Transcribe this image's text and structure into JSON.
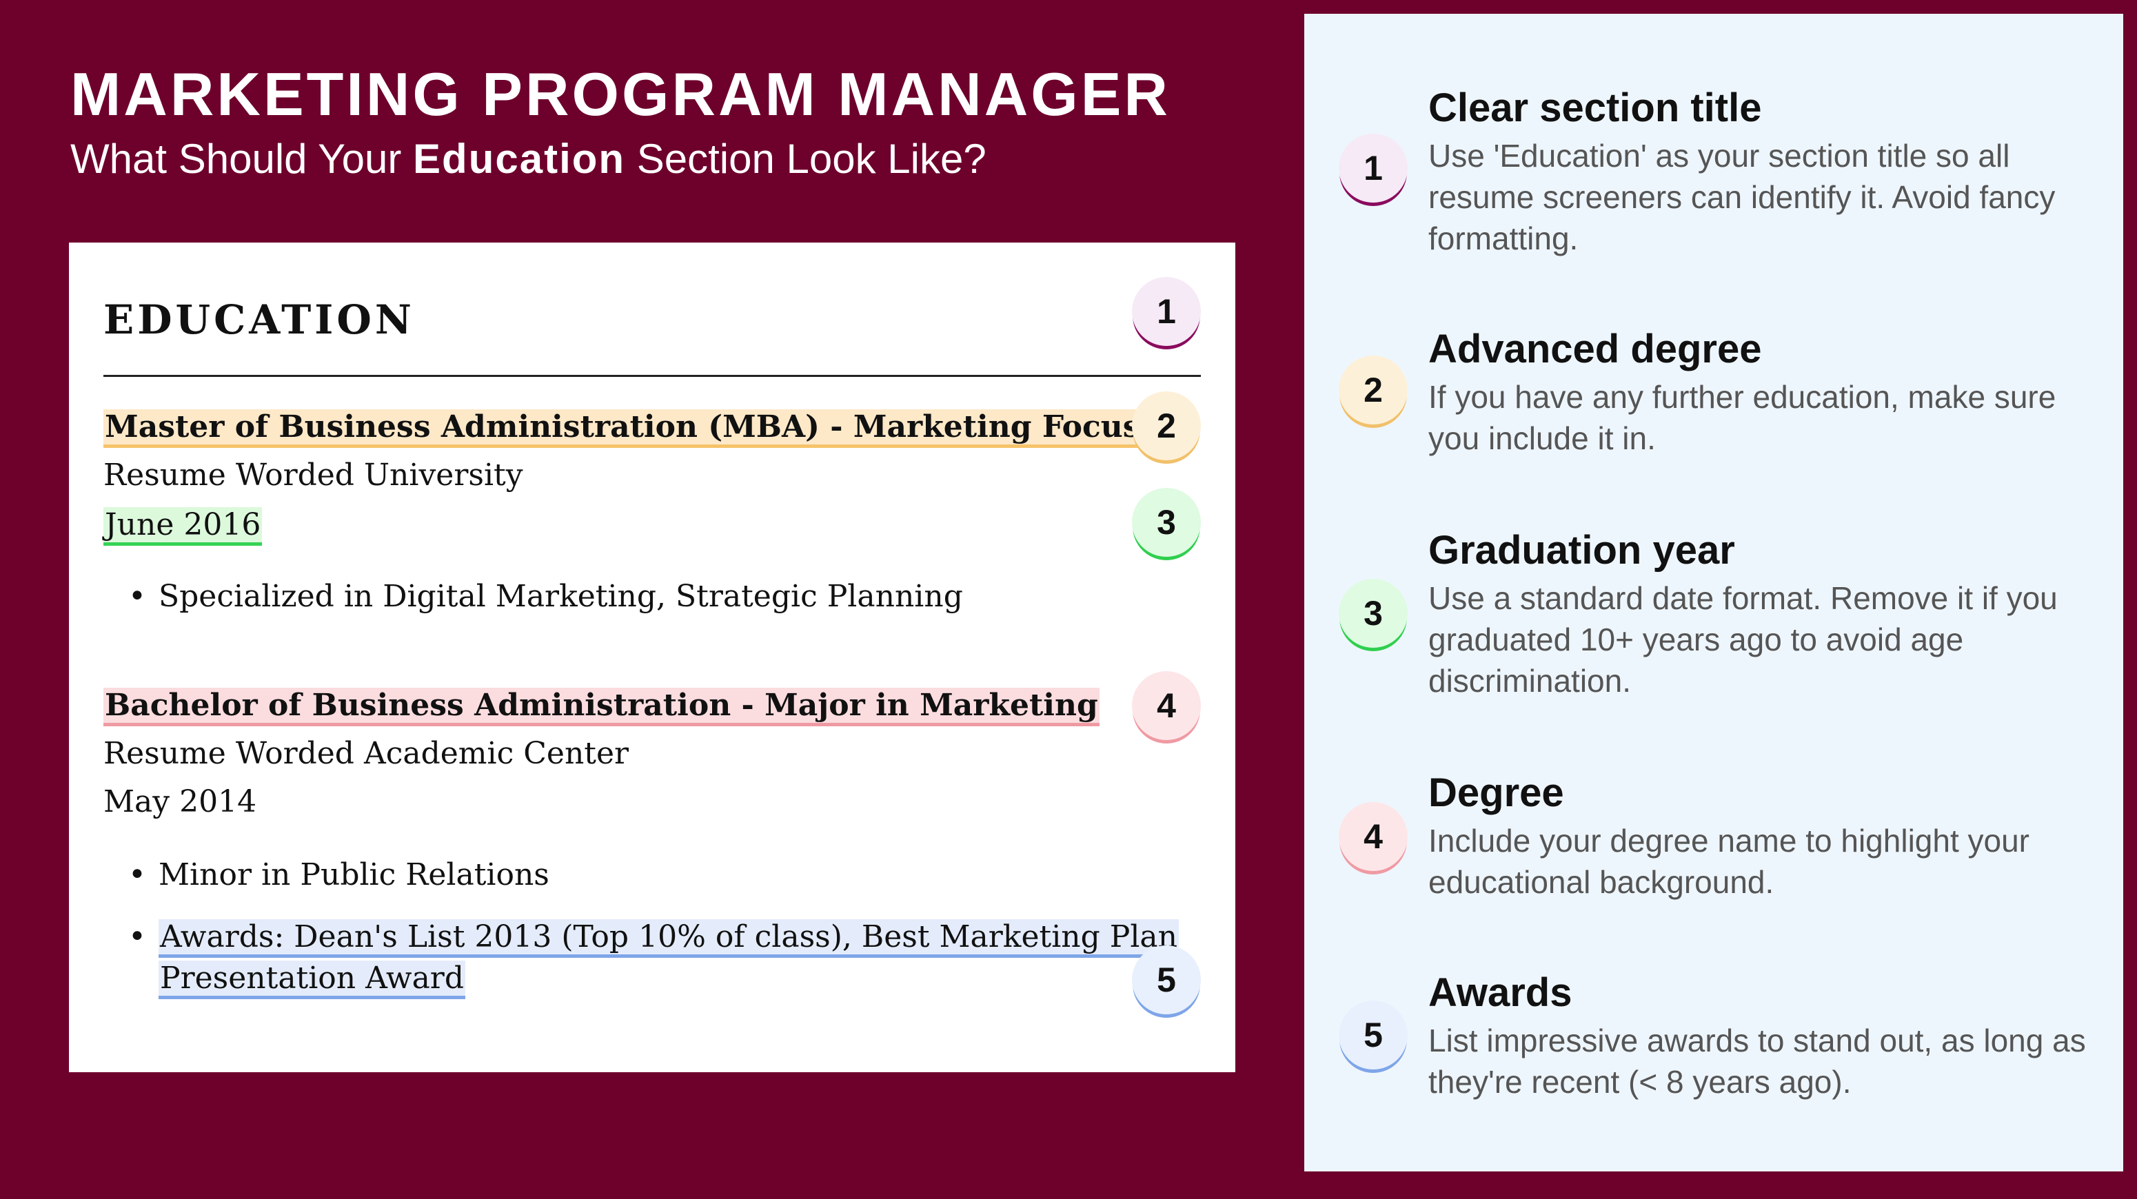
{
  "header": {
    "title": "MARKETING PROGRAM MANAGER",
    "subtitle_pre": "What Should Your ",
    "subtitle_bold": "Education",
    "subtitle_post": " Section Look Like?"
  },
  "resume": {
    "section_title": "EDUCATION",
    "entries": [
      {
        "degree": "Master of Business Administration (MBA) - Marketing Focus",
        "school": "Resume Worded University",
        "date": "June 2016",
        "bullets": [
          "Specialized in Digital Marketing, Strategic Planning"
        ]
      },
      {
        "degree": "Bachelor of Business Administration - Major in Marketing",
        "school": "Resume Worded Academic Center",
        "date": "May 2014",
        "bullets": [
          "Minor in Public Relations"
        ],
        "award_line1": "Awards: Dean's List 2013 (Top 10% of class), Best Marketing Plan",
        "award_line2": "Presentation Award"
      }
    ],
    "bullet_char": "•"
  },
  "badges": [
    "1",
    "2",
    "3",
    "4",
    "5"
  ],
  "tips": [
    {
      "number": "1",
      "title": "Clear section title",
      "desc": "Use 'Education' as your section title so all resume screeners can identify it. Avoid fancy formatting."
    },
    {
      "number": "2",
      "title": "Advanced degree",
      "desc": "If you have any further education, make sure you include it in."
    },
    {
      "number": "3",
      "title": "Graduation year",
      "desc": "Use a standard date format. Remove it if you graduated 10+ years ago to avoid age discrimination."
    },
    {
      "number": "4",
      "title": "Degree",
      "desc": "Include your degree name to highlight your educational background."
    },
    {
      "number": "5",
      "title": "Awards",
      "desc": "List impressive awards to stand out, as long as they're recent (< 8 years ago)."
    }
  ],
  "colors": {
    "background": "#6e002c",
    "panel": "#eef6fd",
    "badge1": "#8a0c5e",
    "badge2": "#f1c06a",
    "badge3": "#2fcf4e",
    "badge4": "#ef9aa3",
    "badge5": "#7ea5e8"
  }
}
